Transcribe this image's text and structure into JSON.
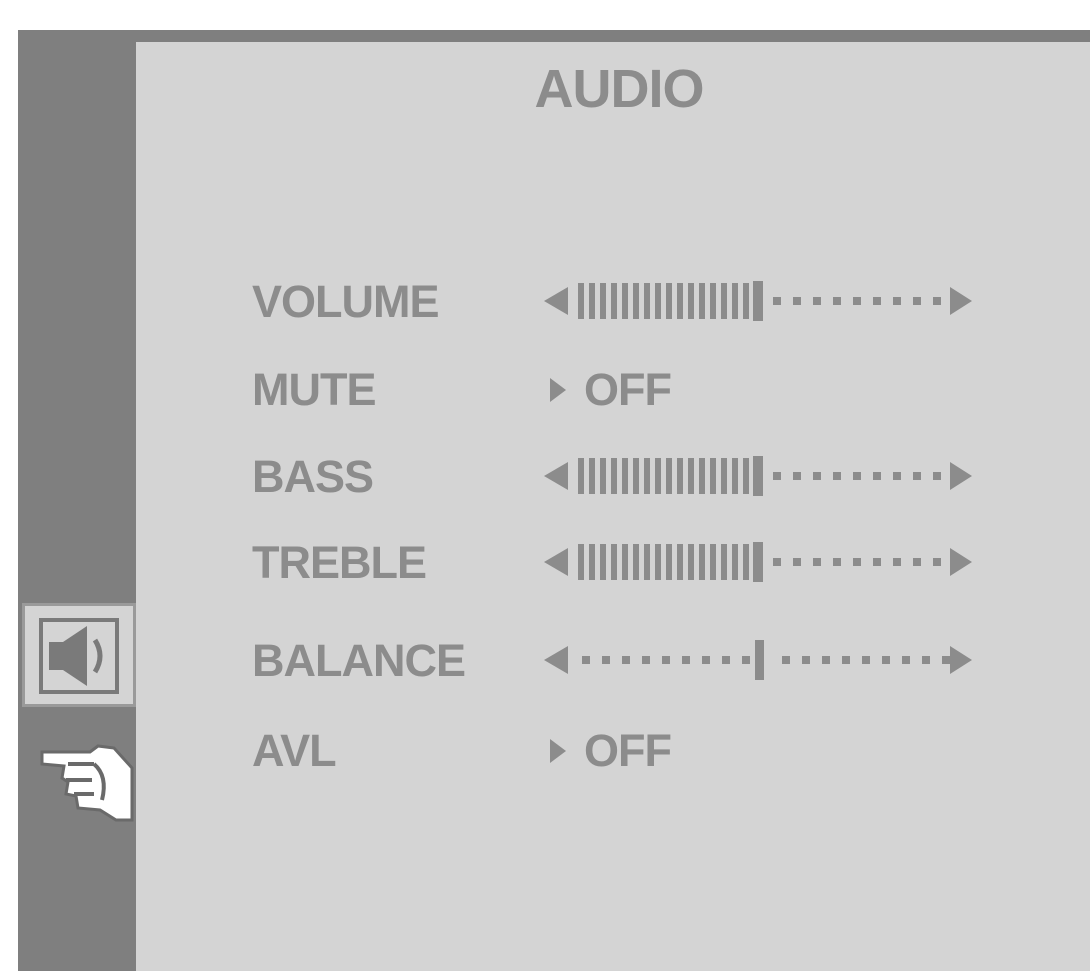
{
  "menu": {
    "title": "AUDIO"
  },
  "sidebar": {
    "items": [
      {
        "icon": "speaker-icon",
        "selected": true
      },
      {
        "icon": "pointing-hand-icon",
        "selected": false
      }
    ]
  },
  "settings": {
    "volume": {
      "label": "VOLUME",
      "level": 0.5
    },
    "mute": {
      "label": "MUTE",
      "value": "OFF"
    },
    "bass": {
      "label": "BASS",
      "level": 0.5
    },
    "treble": {
      "label": "TREBLE",
      "level": 0.5
    },
    "balance": {
      "label": "BALANCE",
      "position": 0.5
    },
    "avl": {
      "label": "AVL",
      "value": "OFF"
    }
  },
  "colors": {
    "sidebar": "#7f7f7f",
    "panel": "#d4d4d4",
    "text": "#8c8c8c"
  }
}
